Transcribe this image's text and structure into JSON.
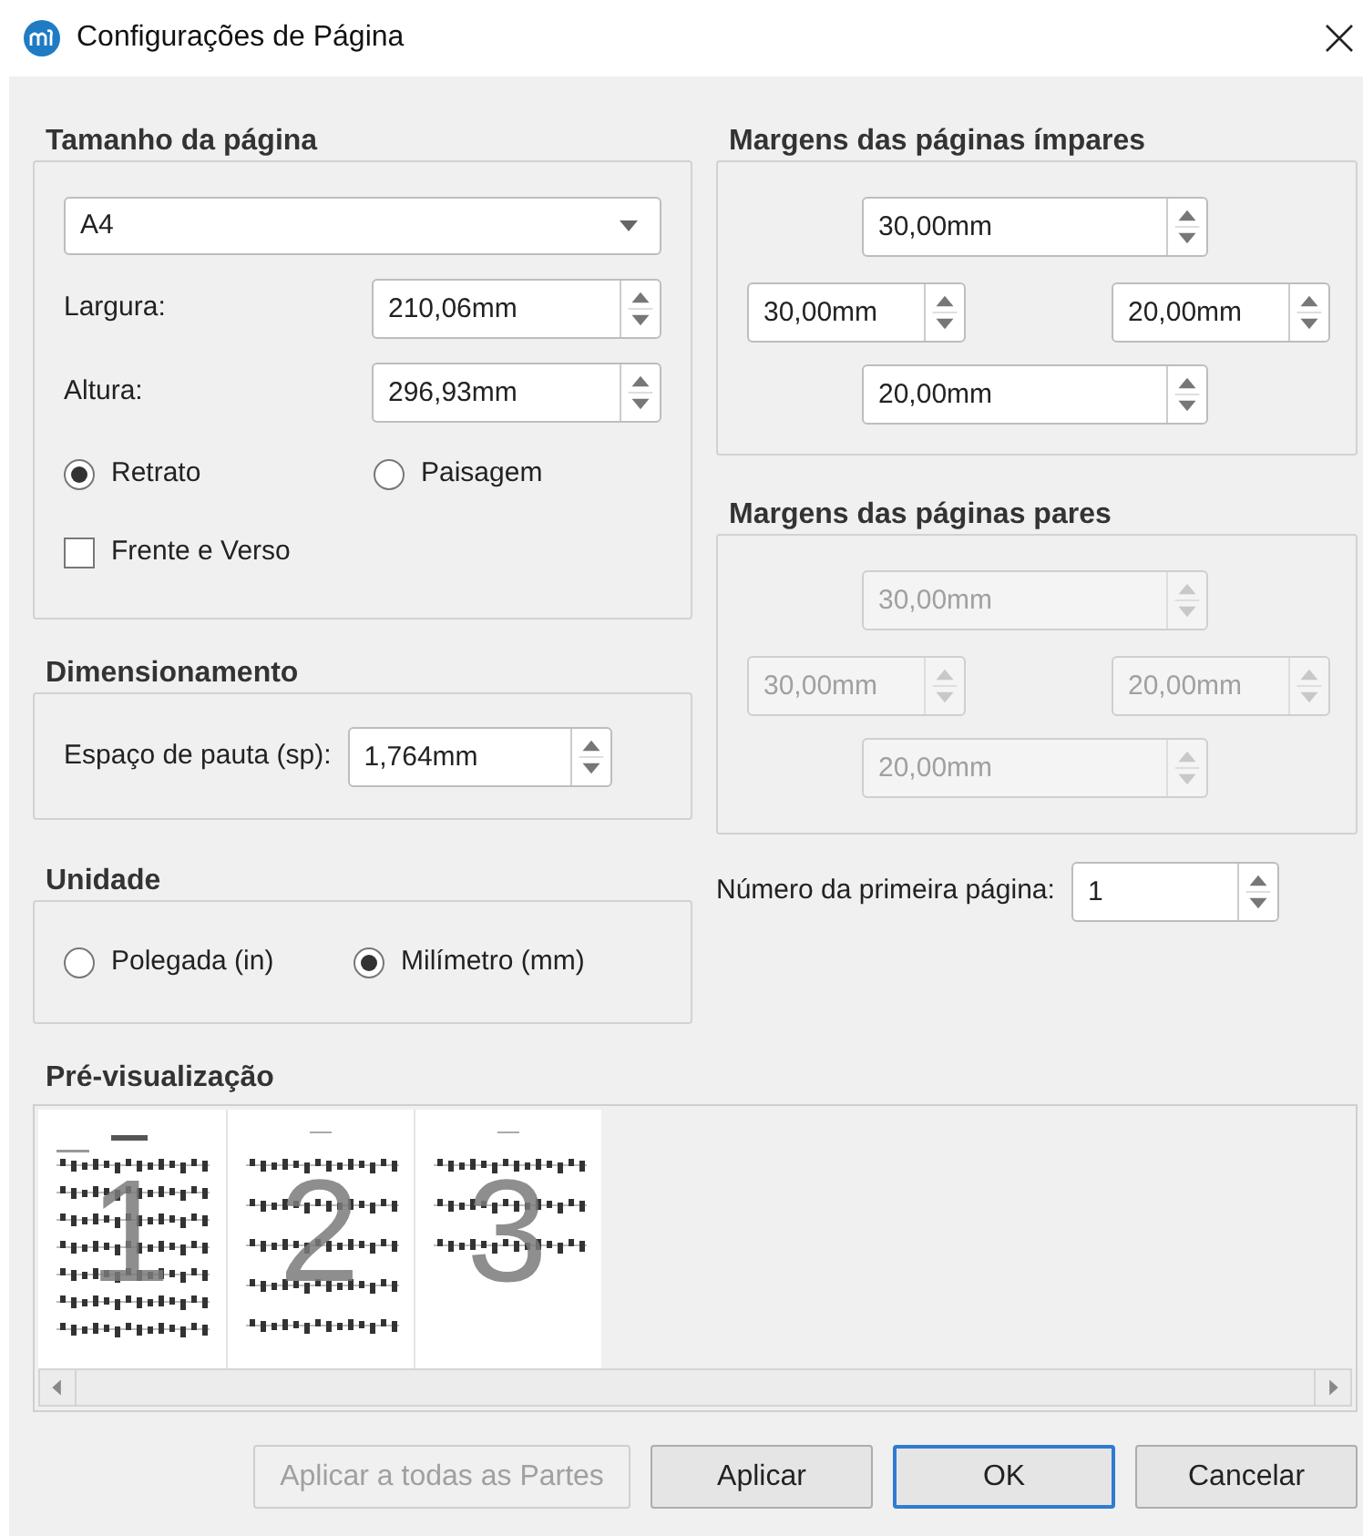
{
  "window": {
    "title": "Configurações de Página"
  },
  "page_size": {
    "title": "Tamanho da página",
    "paper": "A4",
    "fields": [
      {
        "label": "Largura:",
        "value": "210,06mm"
      },
      {
        "label": "Altura:",
        "value": "296,93mm"
      }
    ],
    "orientation": [
      {
        "label": "Retrato",
        "selected": true
      },
      {
        "label": "Paisagem",
        "selected": false
      }
    ],
    "two_sided": {
      "label": "Frente e Verso",
      "checked": false
    }
  },
  "scaling": {
    "title": "Dimensionamento",
    "label": "Espaço de pauta (sp):",
    "value": "1,764mm"
  },
  "unit": {
    "title": "Unidade",
    "options": [
      {
        "label": "Polegada (in)",
        "selected": false
      },
      {
        "label": "Milímetro (mm)",
        "selected": true
      }
    ]
  },
  "odd_margins": {
    "title": "Margens das páginas ímpares",
    "disabled": false,
    "top": "30,00mm",
    "left": "30,00mm",
    "right": "20,00mm",
    "bottom": "20,00mm"
  },
  "even_margins": {
    "title": "Margens das páginas pares",
    "disabled": true,
    "top": "30,00mm",
    "left": "30,00mm",
    "right": "20,00mm",
    "bottom": "20,00mm"
  },
  "first_page": {
    "label": "Número da primeira página:",
    "value": "1"
  },
  "preview": {
    "title": "Pré-visualização",
    "pages": [
      {
        "number": "1"
      },
      {
        "number": "2"
      },
      {
        "number": "3"
      }
    ]
  },
  "buttons": [
    {
      "label": "Aplicar a todas as Partes",
      "disabled": true,
      "default": false
    },
    {
      "label": "Aplicar",
      "disabled": false,
      "default": false
    },
    {
      "label": "OK",
      "disabled": false,
      "default": true
    },
    {
      "label": "Cancelar",
      "disabled": false,
      "default": false
    }
  ]
}
